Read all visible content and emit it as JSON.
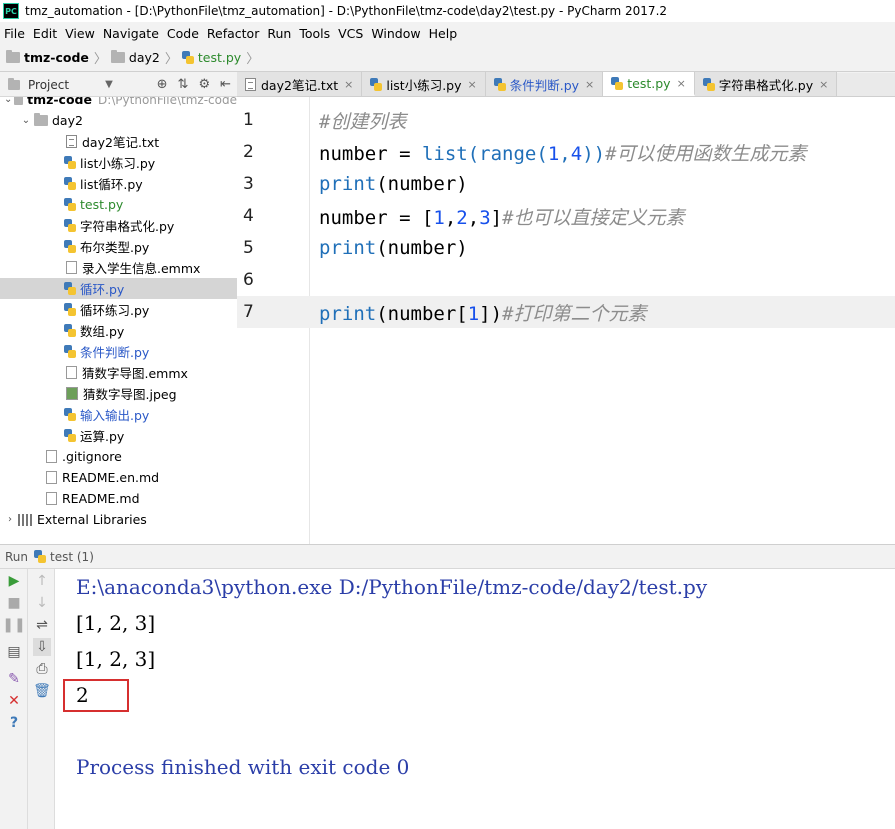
{
  "window": {
    "title": "tmz_automation - [D:\\PythonFile\\tmz_automation] - D:\\PythonFile\\tmz-code\\day2\\test.py - PyCharm 2017.2",
    "app_icon": "PC"
  },
  "menu": [
    "File",
    "Edit",
    "View",
    "Navigate",
    "Code",
    "Refactor",
    "Run",
    "Tools",
    "VCS",
    "Window",
    "Help"
  ],
  "breadcrumb": [
    "tmz-code",
    "day2",
    "test.py"
  ],
  "project": {
    "header_label": "Project",
    "root_name": "tmz-code",
    "root_path": "D:\\PythonFile\\tmz-code",
    "folder": "day2",
    "files": [
      "day2笔记.txt",
      "list小练习.py",
      "list循环.py",
      "test.py",
      "字符串格式化.py",
      "布尔类型.py",
      "录入学生信息.emmx",
      "循环.py",
      "循环练习.py",
      "数组.py",
      "条件判断.py",
      "猜数字导图.emmx",
      "猜数字导图.jpeg",
      "输入输出.py",
      "运算.py"
    ],
    "root_files": [
      ".gitignore",
      "README.en.md",
      "README.md"
    ],
    "external": "External Libraries"
  },
  "tabs": [
    "day2笔记.txt",
    "list小练习.py",
    "条件判断.py",
    "test.py",
    "字符串格式化.py"
  ],
  "active_tab": 3,
  "editor": {
    "line_numbers": [
      "1",
      "2",
      "3",
      "4",
      "5",
      "6",
      "7"
    ],
    "lines": {
      "l1": {
        "comment": "#创建列表"
      },
      "l2": {
        "a": "number = ",
        "b": "list",
        "c": "(",
        "d": "range",
        "e": "(",
        "f": "1",
        "g": ",",
        "h": "4",
        "i": "))",
        "comment": "#可以使用函数生成元素"
      },
      "l3": {
        "b": "print",
        "rest": "(number)"
      },
      "l4": {
        "a": "number = [",
        "n1": "1",
        "s1": ",",
        "n2": "2",
        "s2": ",",
        "n3": "3",
        "e": "]",
        "comment": "#也可以直接定义元素"
      },
      "l5": {
        "b": "print",
        "rest": "(number)"
      },
      "l7": {
        "b": "print",
        "a": "(number[",
        "n": "1",
        "e": "])",
        "comment": "#打印第二个元素"
      }
    }
  },
  "run": {
    "label": "Run",
    "config": "test (1)"
  },
  "console": {
    "cmd": "E:\\anaconda3\\python.exe D:/PythonFile/tmz-code/day2/test.py",
    "out1": "[1, 2, 3]",
    "out2": "[1, 2, 3]",
    "out3": "2",
    "finish": "Process finished with exit code 0"
  },
  "colors": {
    "highlight_box": "#d62f2f",
    "console_blue": "#2b3ea8",
    "modified_file_blue": "#2a58c7",
    "new_file_green": "#2c8a2c"
  }
}
